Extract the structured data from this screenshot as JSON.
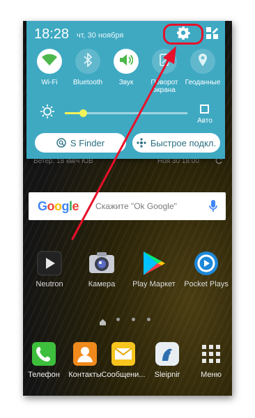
{
  "status_bar": {
    "time": "18:28",
    "date": "чт, 30 ноября",
    "settings_icon": "gear-icon",
    "edit_icon": "grid-edit-icon"
  },
  "quick_toggles": [
    {
      "label": "Wi-Fi",
      "icon": "wifi-icon",
      "on": true
    },
    {
      "label": "Bluetooth",
      "icon": "bluetooth-icon",
      "on": false
    },
    {
      "label": "Звук",
      "icon": "speaker-icon",
      "on": true
    },
    {
      "label": "Поворот экрана",
      "icon": "rotate-icon",
      "on": false
    },
    {
      "label": "Геоданные",
      "icon": "location-icon",
      "on": false
    }
  ],
  "brightness": {
    "level": 0.15,
    "auto_label": "Авто"
  },
  "pills": {
    "s_finder": "S Finder",
    "quick_connect": "Быстрое подкл."
  },
  "weather": {
    "left": "Ветер: 18 км/ч ЮВ",
    "right": "Ноя 30  18:00"
  },
  "search": {
    "logo": "Google",
    "hint": "Скажите \"Ok Google\""
  },
  "apps": [
    {
      "label": "Neutron",
      "icon": "neutron-icon"
    },
    {
      "label": "Камера",
      "icon": "camera-icon"
    },
    {
      "label": "Play Маркет",
      "icon": "play-store-icon"
    },
    {
      "label": "Pocket Plays",
      "icon": "pocket-plays-icon"
    }
  ],
  "dock": [
    {
      "label": "Телефон",
      "icon": "phone-icon"
    },
    {
      "label": "Контакты",
      "icon": "contacts-icon"
    },
    {
      "label": "Сообщени...",
      "icon": "messages-icon"
    },
    {
      "label": "Sleipnir",
      "icon": "sleipnir-icon"
    },
    {
      "label": "Меню",
      "icon": "apps-grid-icon"
    }
  ],
  "colors": {
    "panel": "#3fa9c2",
    "highlight": "#e8102a",
    "slider": "#f2f25a"
  }
}
